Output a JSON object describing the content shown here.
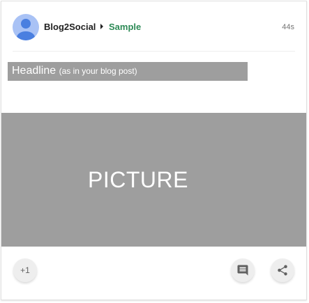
{
  "post": {
    "author": "Blog2Social",
    "audience": "Sample",
    "timestamp": "44s",
    "headline": {
      "main": "Headline",
      "sub": "(as in your blog post)"
    },
    "picture_label": "PICTURE"
  },
  "actions": {
    "plus_one_label": "+1",
    "comment_icon": "comment-icon",
    "share_icon": "share-icon"
  },
  "colors": {
    "audience": "#2e8b57",
    "placeholder_gray": "#9e9e9e",
    "avatar_bg": "#a9c2f5",
    "avatar_fg": "#4a7fe0"
  }
}
